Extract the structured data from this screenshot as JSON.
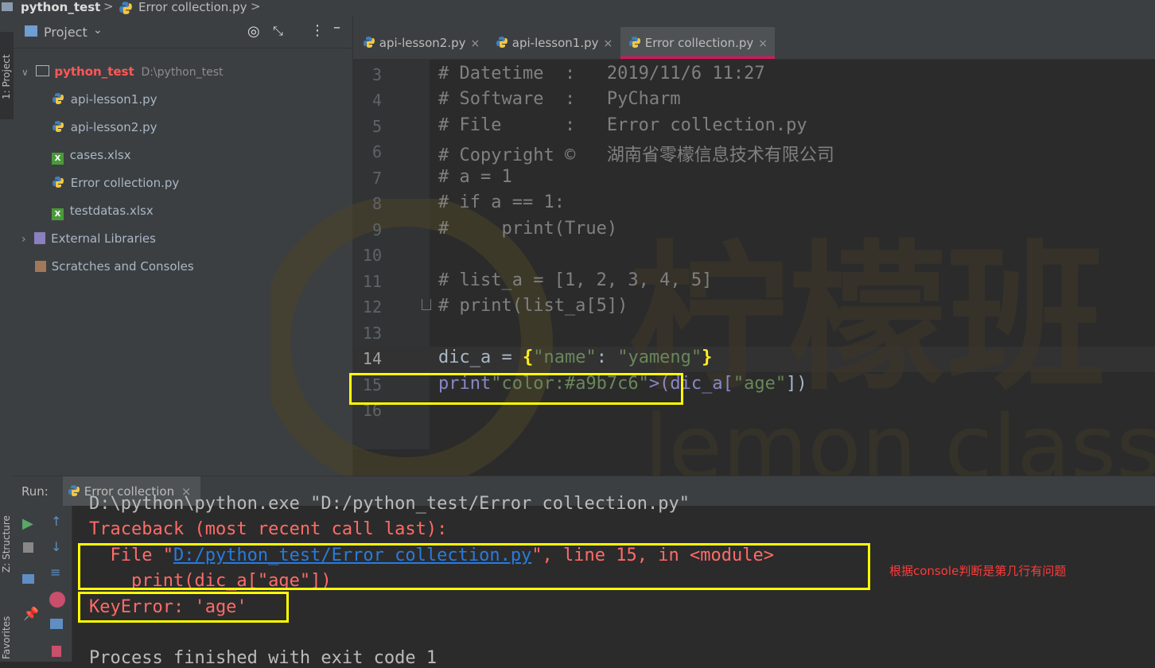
{
  "breadcrumb": {
    "project": "python_test",
    "sep": ">",
    "file": "Error collection.py"
  },
  "leftstrip": {
    "project_label": "1: Project",
    "structure_label": "Z: Structure",
    "favorites_label": "Favorites"
  },
  "project_panel": {
    "title": "Project",
    "root": {
      "name": "python_test",
      "path": "D:\\python_test"
    },
    "files": [
      {
        "name": "api-lesson1.py",
        "type": "py"
      },
      {
        "name": "api-lesson2.py",
        "type": "py"
      },
      {
        "name": "cases.xlsx",
        "type": "xlsx"
      },
      {
        "name": "Error collection.py",
        "type": "py"
      },
      {
        "name": "testdatas.xlsx",
        "type": "xlsx"
      }
    ],
    "external": "External Libraries",
    "scratches": "Scratches and Consoles"
  },
  "tabs": [
    {
      "label": "api-lesson2.py",
      "close": "×"
    },
    {
      "label": "api-lesson1.py",
      "close": "×"
    },
    {
      "label": "Error collection.py",
      "close": "×",
      "active": true
    }
  ],
  "editor": {
    "line_numbers": [
      "3",
      "4",
      "5",
      "6",
      "7",
      "8",
      "9",
      "10",
      "11",
      "12",
      "13",
      "14",
      "15",
      "16"
    ],
    "lines": [
      "# Datetime  :   2019/11/6 11:27",
      "# Software  :   PyCharm",
      "# File      :   Error collection.py",
      "# Copyright ©   湖南省零檬信息技术有限公司",
      "# a = 1",
      "# if a == 1:",
      "#     print(True)",
      "",
      "# list_a = [1, 2, 3, 4, 5]",
      "# print(list_a[5])",
      "",
      "dic_a = {\"name\": \"yameng\"}",
      "print(dic_a[\"age\"])",
      ""
    ]
  },
  "watermark": {
    "brand": "柠檬班",
    "sub": "lemon class Ed"
  },
  "run": {
    "label": "Run:",
    "tab": "Error collection",
    "close": "×",
    "console": {
      "cmd": "D:\\python\\python.exe \"D:/python_test/Error collection.py\"",
      "traceback": "Traceback (most recent call last):",
      "file_prefix": "  File \"",
      "file_link": "D:/python_test/Error collection.py",
      "file_suffix": "\", line 15, in <module>",
      "code_line": "    print(dic_a[\"age\"])",
      "error": "KeyError: 'age'",
      "exit": "Process finished with exit code 1"
    },
    "annotation": "根据console判断是第几行有问题"
  },
  "colors": {
    "annotation": "#ff3b3b",
    "highlight_box": "#ffff00",
    "error_text": "#ff6b68",
    "link": "#287bde"
  }
}
